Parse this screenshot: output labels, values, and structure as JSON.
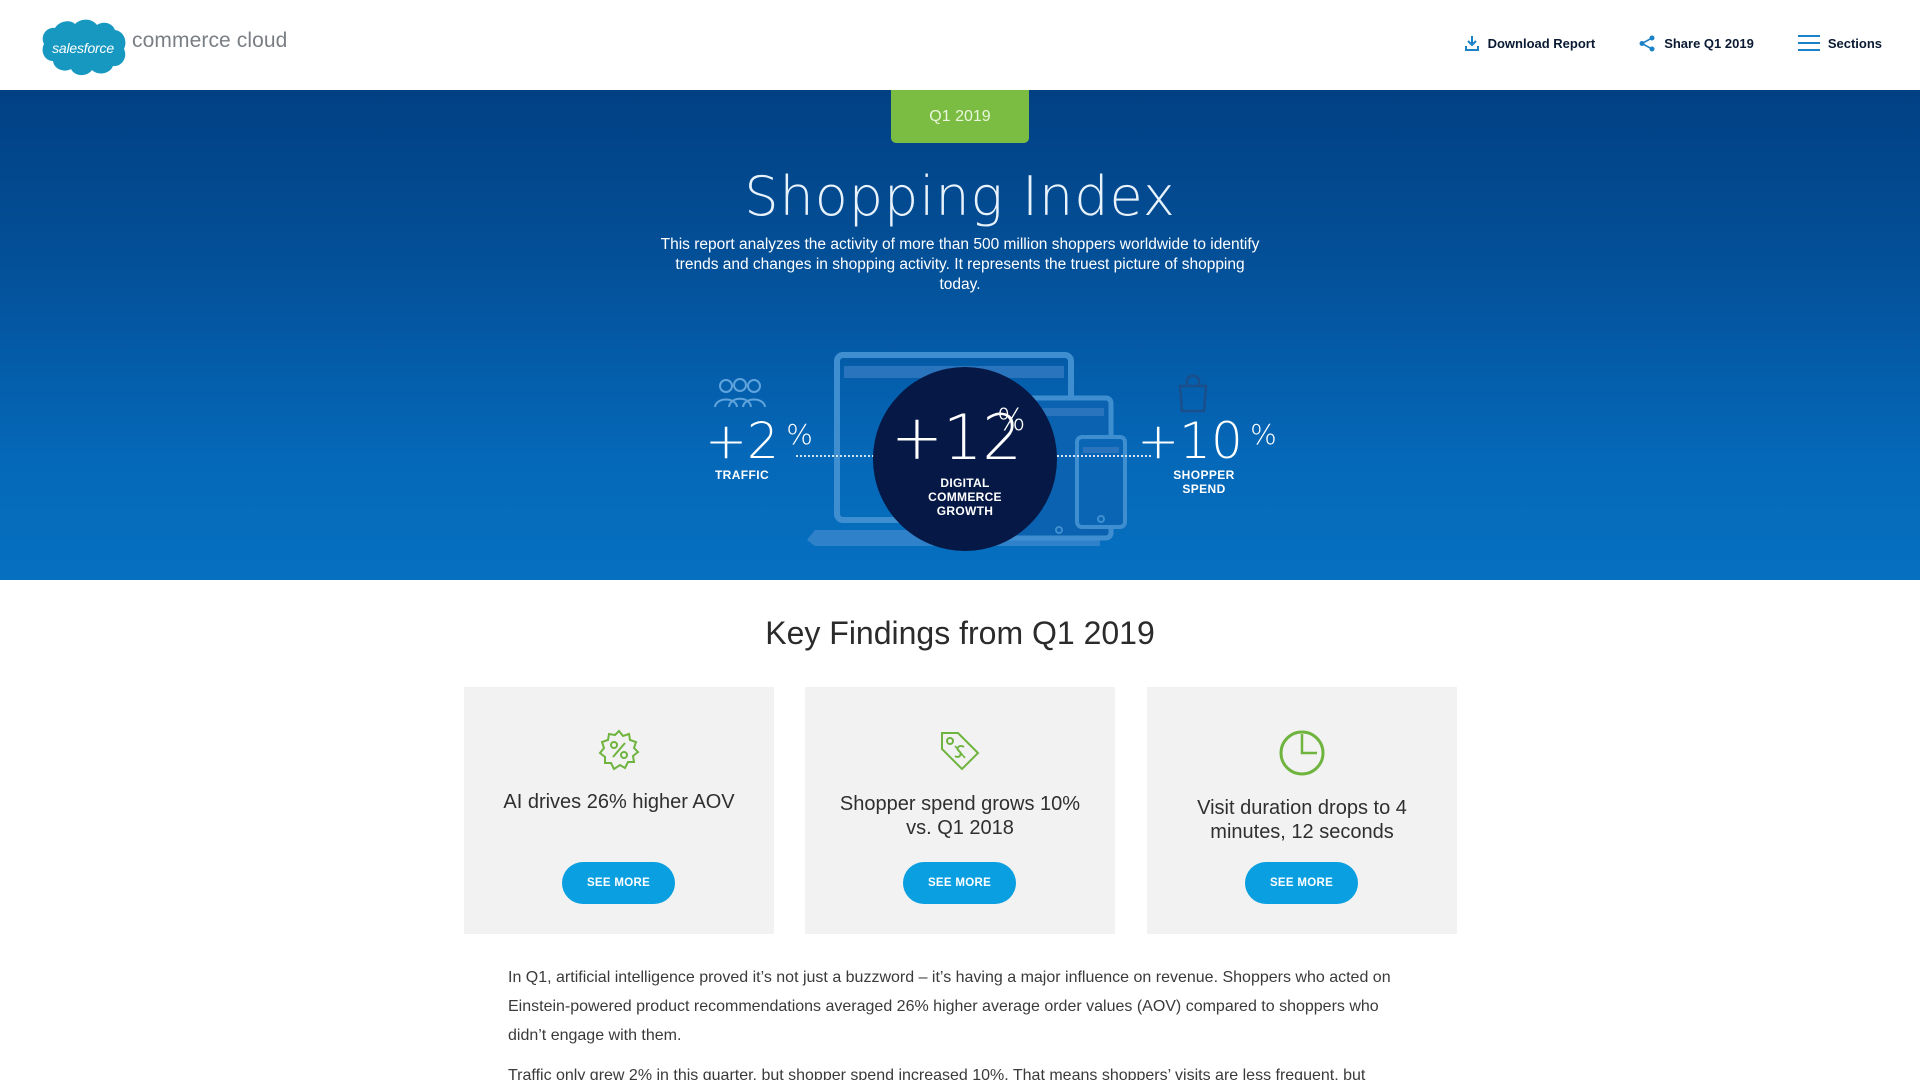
{
  "header": {
    "logo_cloud_text": "salesforce",
    "logo_product_text": "commerce cloud",
    "nav": {
      "download_label": "Download Report",
      "share_label": "Share Q1 2019",
      "sections_label": "Sections"
    }
  },
  "hero": {
    "quarter_tab": "Q1 2019",
    "title": "Shopping Index",
    "description": "This report analyzes the activity of more than 500 million shoppers worldwide to identify trends and changes in shopping activity. It represents the truest picture of shopping today.",
    "stats": {
      "traffic": {
        "value": "+2",
        "unit": "%",
        "label": "TRAFFIC"
      },
      "growth": {
        "value": "+12",
        "unit": "%",
        "label_line1": "DIGITAL",
        "label_line2": "COMMERCE",
        "label_line3": "GROWTH"
      },
      "spend": {
        "value": "+10",
        "unit": "%",
        "label_line1": "SHOPPER",
        "label_line2": "SPEND"
      }
    }
  },
  "key_findings": {
    "title": "Key Findings from Q1 2019",
    "cards": [
      {
        "text": "AI drives 26% higher AOV",
        "button": "SEE MORE",
        "icon": "percent-badge-icon"
      },
      {
        "text": "Shopper spend grows 10% vs. Q1 2018",
        "button": "SEE MORE",
        "icon": "price-tag-icon"
      },
      {
        "text": "Visit duration drops to 4 minutes, 12 seconds",
        "button": "SEE MORE",
        "icon": "clock-icon"
      }
    ]
  },
  "body": {
    "paragraph1": "In Q1, artificial intelligence proved it’s not just a buzzword – it’s having a major influence on revenue. Shoppers who acted on Einstein-powered product recommendations averaged 26% higher average order values (AOV) compared to shoppers who didn’t engage with them.",
    "paragraph2": "Traffic only grew 2% in this quarter, but shopper spend increased 10%. That means shoppers’ visits are less frequent, but"
  },
  "colors": {
    "accent_green": "#7bbc42",
    "button_blue": "#0a9fe0",
    "hero_dark": "#024083",
    "circle_navy": "#061845"
  }
}
